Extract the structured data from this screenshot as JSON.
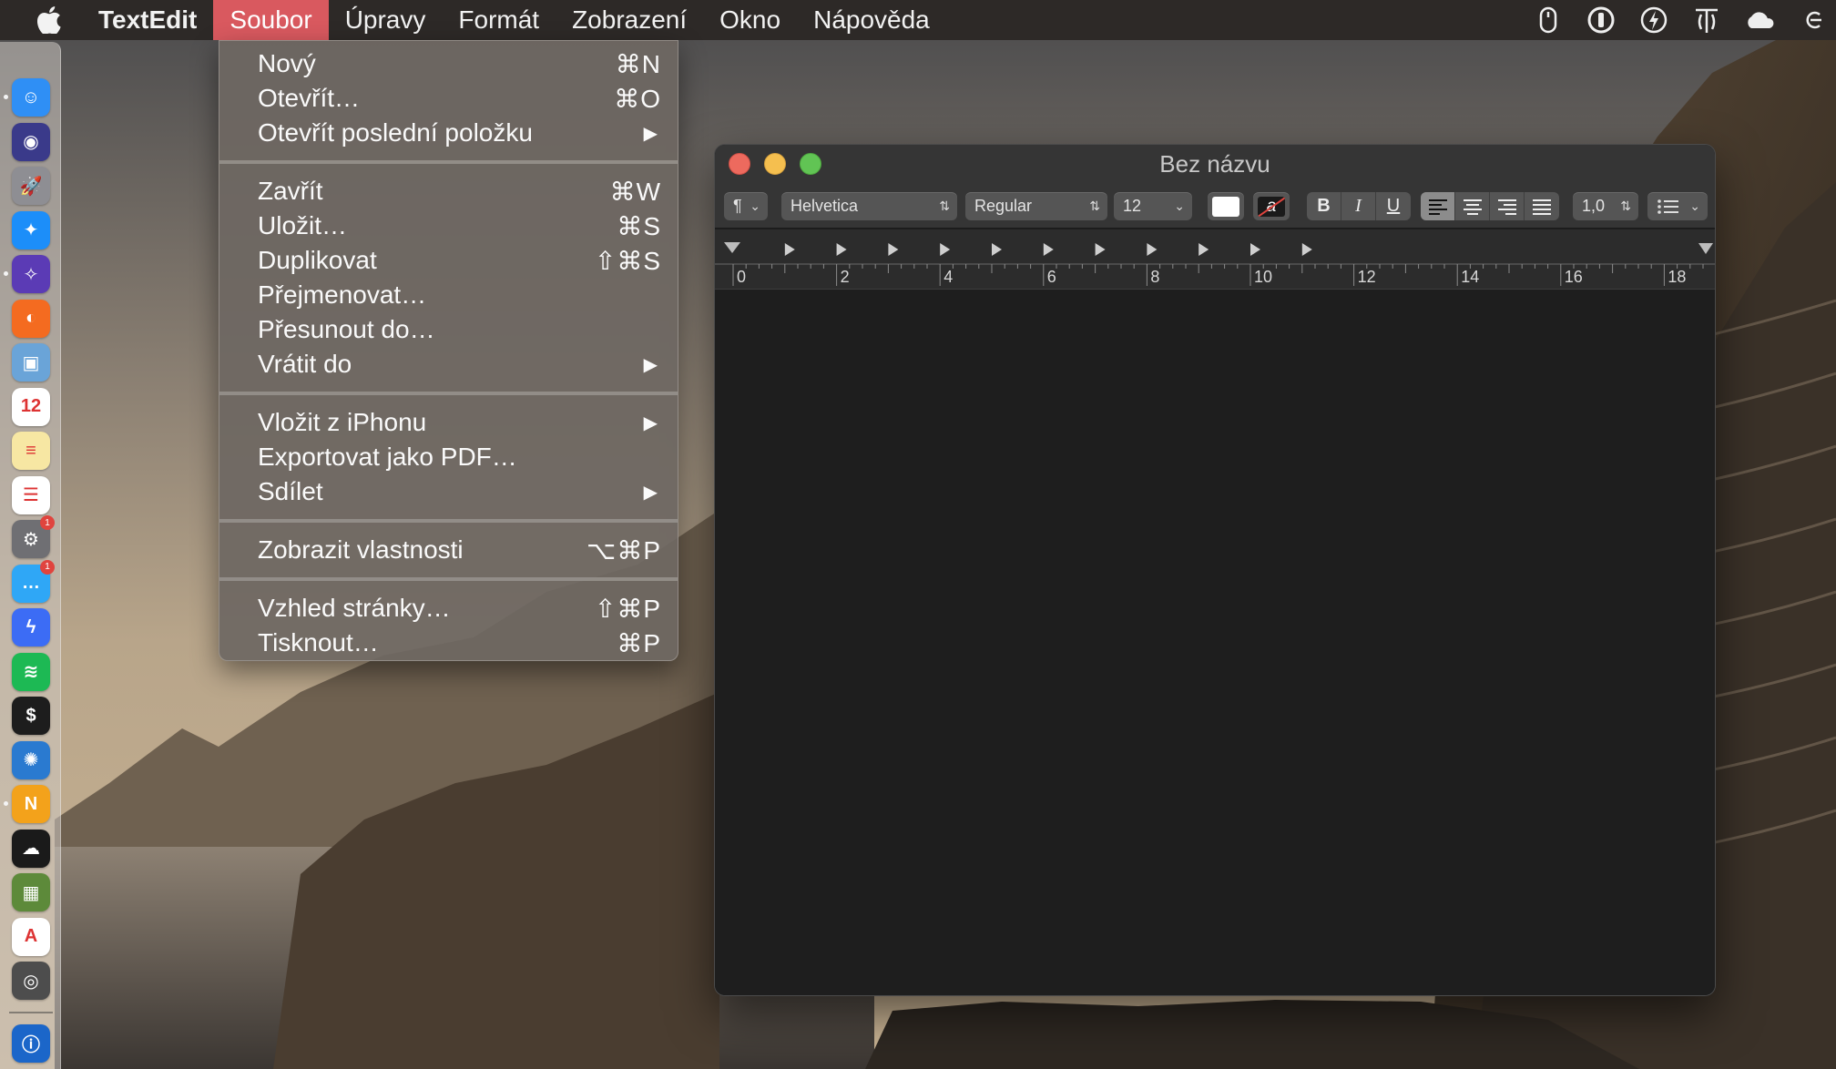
{
  "menubar": {
    "app_name": "TextEdit",
    "menus": [
      "Soubor",
      "Úpravy",
      "Formát",
      "Zobrazení",
      "Okno",
      "Nápověda"
    ],
    "active_menu": "Soubor",
    "active_color": "#d9595f",
    "status_icons": [
      "mouse-icon",
      "onepassword-icon",
      "power-icon",
      "keyboard-icon",
      "cloud-icon",
      "accessibility-icon"
    ]
  },
  "file_menu": {
    "groups": [
      [
        {
          "label": "Nový",
          "shortcut": "⌘N"
        },
        {
          "label": "Otevřít…",
          "shortcut": "⌘O"
        },
        {
          "label": "Otevřít poslední položku",
          "shortcut": "▶"
        }
      ],
      [
        {
          "label": "Zavřít",
          "shortcut": "⌘W"
        },
        {
          "label": "Uložit…",
          "shortcut": "⌘S"
        },
        {
          "label": "Duplikovat",
          "shortcut": "⇧⌘S"
        },
        {
          "label": "Přejmenovat…",
          "shortcut": ""
        },
        {
          "label": "Přesunout do…",
          "shortcut": ""
        },
        {
          "label": "Vrátit do",
          "shortcut": "▶"
        }
      ],
      [
        {
          "label": "Vložit z iPhonu",
          "shortcut": "▶"
        },
        {
          "label": "Exportovat jako PDF…",
          "shortcut": ""
        },
        {
          "label": "Sdílet",
          "shortcut": "▶"
        }
      ],
      [
        {
          "label": "Zobrazit vlastnosti",
          "shortcut": "⌥⌘P"
        }
      ],
      [
        {
          "label": "Vzhled stránky…",
          "shortcut": "⇧⌘P"
        },
        {
          "label": "Tisknout…",
          "shortcut": "⌘P"
        }
      ]
    ]
  },
  "window": {
    "title": "Bez názvu",
    "toolbar": {
      "paragraph_style": "¶",
      "font_family": "Helvetica",
      "font_style": "Regular",
      "font_size": "12",
      "bold": "B",
      "italic": "I",
      "underline": "U",
      "line_spacing": "1,0",
      "text_color": "#ffffff",
      "highlight_letter": "a"
    },
    "ruler_labels": [
      "0",
      "2",
      "4",
      "6",
      "8",
      "10",
      "12",
      "14",
      "16",
      "18"
    ]
  },
  "dock": {
    "apps": [
      {
        "name": "finder-icon",
        "color": "#2f8ff5",
        "glyph": "☺"
      },
      {
        "name": "siri-icon",
        "color": "#3a3a8a",
        "glyph": "◉"
      },
      {
        "name": "launchpad-icon",
        "color": "#8e8e93",
        "glyph": "🚀"
      },
      {
        "name": "safari-icon",
        "color": "#1c8ef9",
        "glyph": "✦"
      },
      {
        "name": "compass-app-icon",
        "color": "#5b3bb5",
        "glyph": "✧"
      },
      {
        "name": "firefox-icon",
        "color": "#f46b20",
        "glyph": "◐"
      },
      {
        "name": "preview-icon",
        "color": "#6aa4d8",
        "glyph": "▣"
      },
      {
        "name": "calendar-icon",
        "color": "#ffffff",
        "glyph": "12"
      },
      {
        "name": "notes-icon",
        "color": "#f7e7a3",
        "glyph": "≡"
      },
      {
        "name": "reminders-icon",
        "color": "#ffffff",
        "glyph": "☰"
      },
      {
        "name": "system-preferences-icon",
        "color": "#6f6f73",
        "glyph": "⚙",
        "badge": "1"
      },
      {
        "name": "messages-icon",
        "color": "#2fa7f6",
        "glyph": "…",
        "badge": "1"
      },
      {
        "name": "messenger-icon",
        "color": "#3c6cf5",
        "glyph": "ϟ"
      },
      {
        "name": "spotify-icon",
        "color": "#1db954",
        "glyph": "≋"
      },
      {
        "name": "terminal-icon",
        "color": "#1d1d1d",
        "glyph": "$"
      },
      {
        "name": "coral-app-icon",
        "color": "#2a7ad0",
        "glyph": "✺"
      },
      {
        "name": "nova-icon",
        "color": "#f3a21b",
        "glyph": "N"
      },
      {
        "name": "cloud-app-icon",
        "color": "#1a1a1a",
        "glyph": "☁"
      },
      {
        "name": "minecraft-icon",
        "color": "#5d8a3a",
        "glyph": "▦"
      },
      {
        "name": "autocad-icon",
        "color": "#ffffff",
        "glyph": "A"
      },
      {
        "name": "disk-utility-icon",
        "color": "#4d4d4d",
        "glyph": "◎"
      },
      {
        "name": "onepassword-dock-icon",
        "color": "#1b66c9",
        "glyph": "ⓘ"
      }
    ]
  }
}
